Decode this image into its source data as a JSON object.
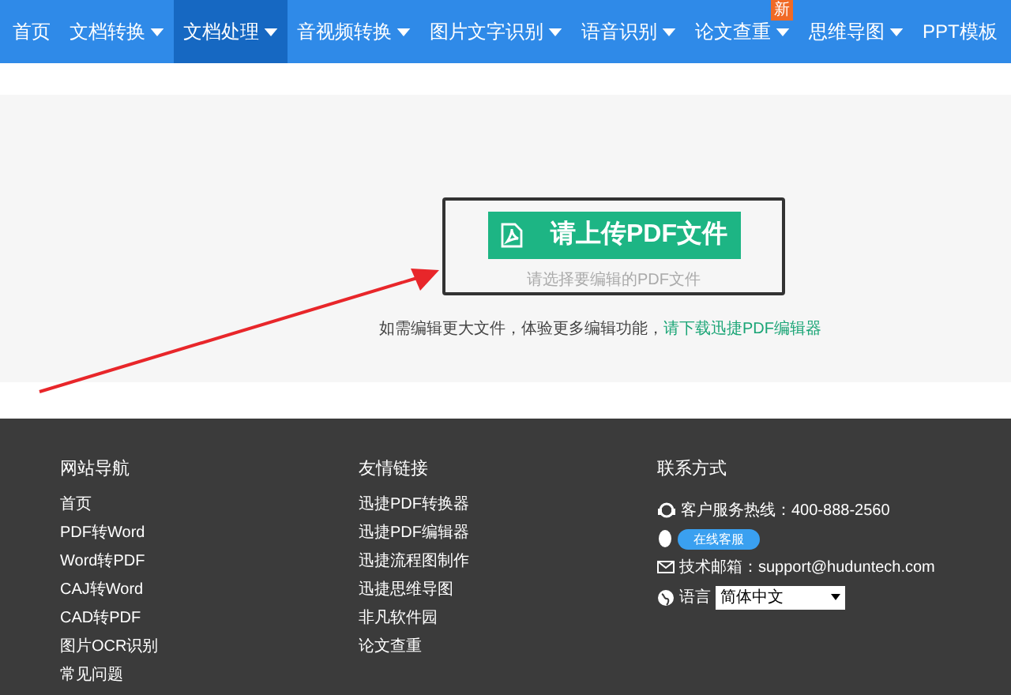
{
  "nav": {
    "items": [
      {
        "label": "首页",
        "dropdown": false,
        "selected": false
      },
      {
        "label": "文档转换",
        "dropdown": true,
        "selected": false
      },
      {
        "label": "文档处理",
        "dropdown": true,
        "selected": true
      },
      {
        "label": "音视频转换",
        "dropdown": true,
        "selected": false
      },
      {
        "label": "图片文字识别",
        "dropdown": true,
        "selected": false
      },
      {
        "label": "语音识别",
        "dropdown": true,
        "selected": false
      },
      {
        "label": "论文查重",
        "dropdown": true,
        "selected": false,
        "badge": "新"
      },
      {
        "label": "思维导图",
        "dropdown": true,
        "selected": false
      },
      {
        "label": "PPT模板",
        "dropdown": false,
        "selected": false
      }
    ]
  },
  "upload": {
    "button": "请上传PDF文件",
    "hint": "请选择要编辑的PDF文件",
    "note": "如需编辑更大文件，体验更多编辑功能，",
    "note_link": "请下载迅捷PDF编辑器"
  },
  "footer": {
    "columns": [
      {
        "title": "网站导航",
        "links": [
          "首页",
          "PDF转Word",
          "Word转PDF",
          "CAJ转Word",
          "CAD转PDF",
          "图片OCR识别",
          "常见问题"
        ]
      },
      {
        "title": "友情链接",
        "links": [
          "迅捷PDF转换器",
          "迅捷PDF编辑器",
          "迅捷流程图制作",
          "迅捷思维导图",
          "非凡软件园",
          "论文查重"
        ]
      }
    ],
    "contact": {
      "title": "联系方式",
      "hotline": "客户服务热线：400-888-2560",
      "online_service": "在线客服",
      "email": "技术邮箱：support@huduntech.com",
      "language_label": "语言",
      "language_value": "简体中文"
    }
  }
}
